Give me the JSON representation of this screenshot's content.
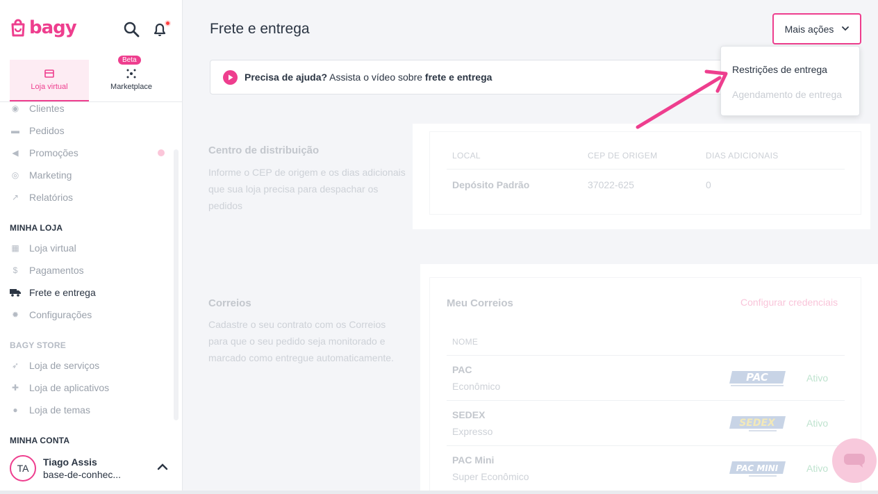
{
  "brand": {
    "logo_text": "bagy",
    "accent": "#ee3e8e"
  },
  "top_icons": {
    "search": "search-icon",
    "notifications": "bell-icon"
  },
  "tabs": [
    {
      "label": "Loja virtual",
      "icon": "storefront-icon",
      "active": true
    },
    {
      "label": "Marketplace",
      "icon": "network-icon",
      "badge": "Beta"
    }
  ],
  "nav": {
    "items_top": [
      {
        "label": "Clientes",
        "icon": "user-circle-icon"
      },
      {
        "label": "Pedidos",
        "icon": "inbox-icon"
      },
      {
        "label": "Promoções",
        "icon": "megaphone-icon"
      },
      {
        "label": "Marketing",
        "icon": "target-icon"
      },
      {
        "label": "Relatórios",
        "icon": "chart-icon"
      }
    ],
    "section_minha_loja": "MINHA LOJA",
    "items_loja": [
      {
        "label": "Loja virtual",
        "icon": "store-icon"
      },
      {
        "label": "Pagamentos",
        "icon": "dollar-icon"
      },
      {
        "label": "Frete e entrega",
        "icon": "truck-icon",
        "active": true
      },
      {
        "label": "Configurações",
        "icon": "gear-icon"
      }
    ],
    "section_store": "BAGY STORE",
    "items_store": [
      {
        "label": "Loja de serviços",
        "icon": "rocket-icon"
      },
      {
        "label": "Loja de aplicativos",
        "icon": "puzzle-icon"
      },
      {
        "label": "Loja de temas",
        "icon": "palette-icon"
      }
    ],
    "section_conta": "MINHA CONTA"
  },
  "user": {
    "initials": "TA",
    "name": "Tiago Assis",
    "store": "base-de-conhec..."
  },
  "header": {
    "title": "Frete e entrega",
    "more_actions": "Mais ações"
  },
  "help": {
    "prefix": "Precisa de ajuda?",
    "middle": " Assista o vídeo sobre ",
    "topic": "frete e entrega"
  },
  "dropdown": {
    "items": [
      "Restrições de entrega",
      "Agendamento de entrega"
    ]
  },
  "distribution": {
    "title": "Centro de distribuição",
    "description": "Informe o CEP de origem e os dias adicionais que sua loja precisa para despachar os pedidos",
    "columns": [
      "LOCAL",
      "CEP DE ORIGEM",
      "DIAS ADICIONAIS"
    ],
    "rows": [
      {
        "local": "Depósito Padrão",
        "cep": "37022-625",
        "dias": "0"
      }
    ]
  },
  "correios": {
    "title": "Correios",
    "description": "Cadastre o seu contrato com os Correios para que o seu pedido seja monitorado e marcado como entregue automaticamente.",
    "card_title": "Meu Correios",
    "configure_link": "Configurar credenciais",
    "column": "NOME",
    "services": [
      {
        "name": "PAC",
        "sub": "Econômico",
        "logo": "PAC",
        "status": "Ativo"
      },
      {
        "name": "SEDEX",
        "sub": "Expresso",
        "logo": "SEDEX",
        "status": "Ativo"
      },
      {
        "name": "PAC Mini",
        "sub": "Super Econômico",
        "logo": "PAC MINI",
        "status": "Ativo"
      }
    ]
  }
}
